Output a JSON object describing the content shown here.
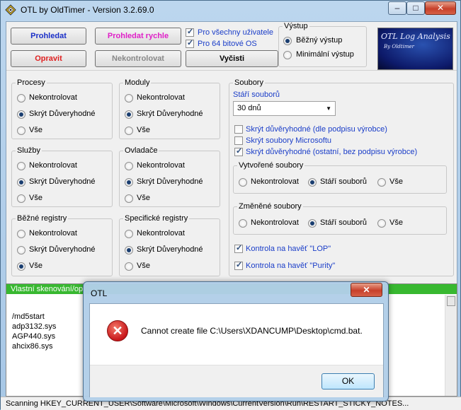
{
  "window": {
    "title": "OTL by OldTimer - Version 3.2.69.0",
    "minimize_glyph": "–",
    "maximize_glyph": "□",
    "close_glyph": "✕"
  },
  "toolbar": {
    "scan_label": "Prohledat",
    "quick_scan_label": "Prohledat rychle",
    "fix_label": "Opravit",
    "none_label": "Nekontrolovat",
    "cleanup_label": "Vyčisti",
    "all_users_label": "Pro všechny uživatele",
    "os64_label": "Pro 64 bitové OS"
  },
  "output": {
    "title": "Výstup",
    "standard_label": "Běžný výstup",
    "minimal_label": "Minimální výstup"
  },
  "logo": {
    "title": "OTL Log Analysis",
    "subtitle": "By Oldtimer"
  },
  "groups": {
    "processes": "Procesy",
    "modules": "Moduly",
    "services": "Služby",
    "drivers": "Ovladače",
    "std_registry": "Běžné registry",
    "specific_registry": "Specifické registry"
  },
  "options": {
    "none": "Nekontrolovat",
    "hide_trusted": "Skrýt Důveryhodné",
    "all": "Vše"
  },
  "files": {
    "title": "Soubory",
    "age_label": "Stáří souborů",
    "age_value": "30 dnů",
    "cb_trusted_signed": "Skrýt důvěryhodné (dle podpisu výrobce)",
    "cb_microsoft": "Skrýt soubory Microsoftu",
    "cb_trusted_other": "Skrýt důvěryhodné (ostatní, bez podpisu výrobce)",
    "created_title": "Vytvořené soubory",
    "changed_title": "Změněné soubory",
    "opt_none": "Nekontrolovat",
    "opt_age": "Stáří souborů",
    "opt_all": "Vše",
    "lop_label": "Kontrola na havěť \"LOP\"",
    "purity_label": "Kontrola na havěť \"Purity\""
  },
  "custom_scan": {
    "header": "Vlastní skenování/op",
    "lines": [
      "/md5start",
      "adp3132.sys",
      "AGP440.sys",
      "ahcix86.sys"
    ]
  },
  "status": "Scanning HKEY_CURRENT_USER\\Software\\Microsoft\\Windows\\CurrentVersion\\Run\\RESTART_STICKY_NOTES...",
  "dialog": {
    "title": "OTL",
    "message": "Cannot create file C:\\Users\\XDANCUMP\\Desktop\\cmd.bat.",
    "ok_label": "OK",
    "close_glyph": "✕",
    "error_glyph": "✕"
  }
}
